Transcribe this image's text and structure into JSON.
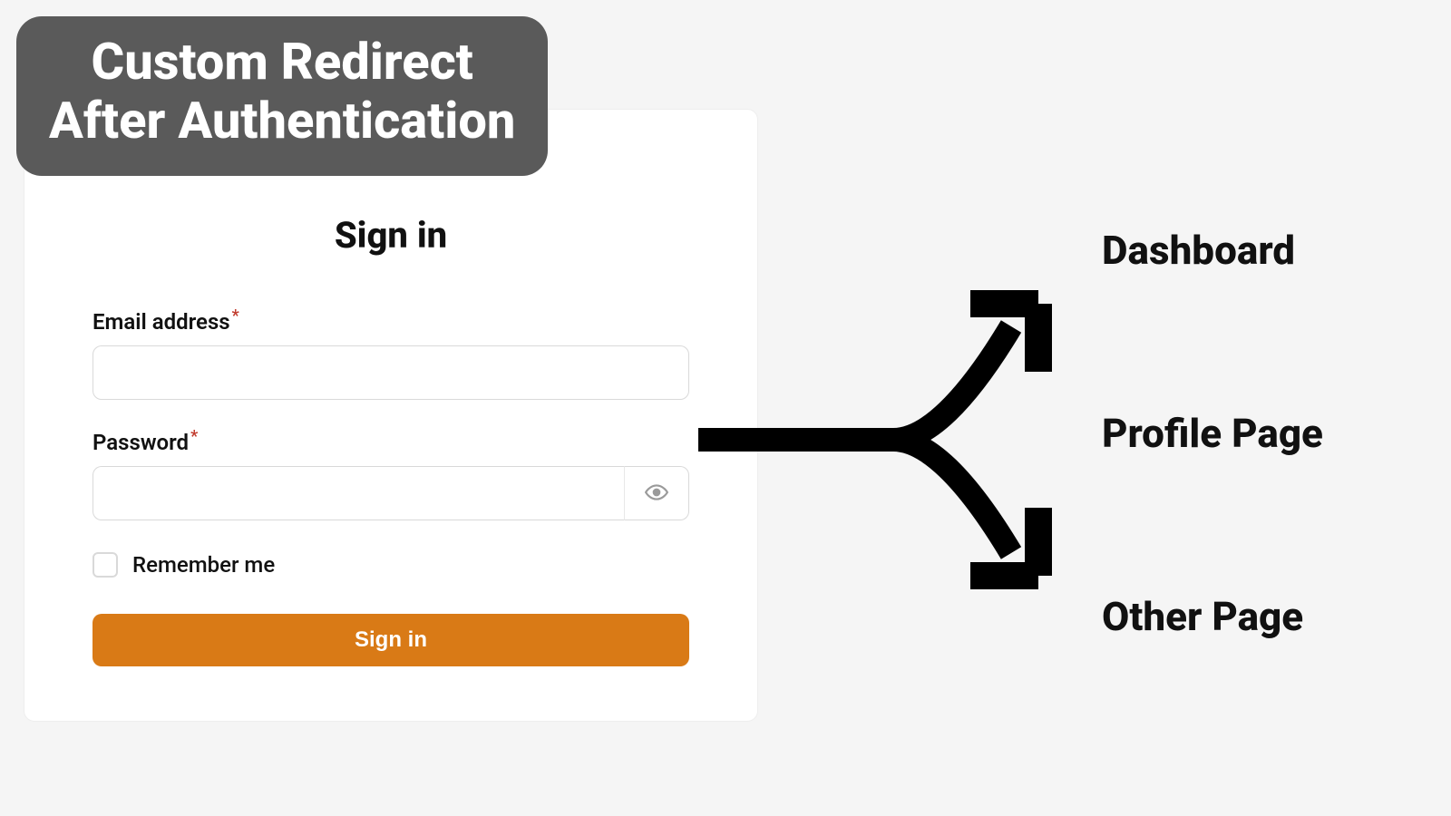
{
  "banner": {
    "line1": "Custom Redirect",
    "line2": "After Authentication"
  },
  "form": {
    "title": "Sign in",
    "email_label": "Email address",
    "password_label": "Password",
    "remember_label": "Remember me",
    "submit_label": "Sign in",
    "email_value": "",
    "password_value": ""
  },
  "destinations": [
    "Dashboard",
    "Profile Page",
    "Other Page"
  ]
}
